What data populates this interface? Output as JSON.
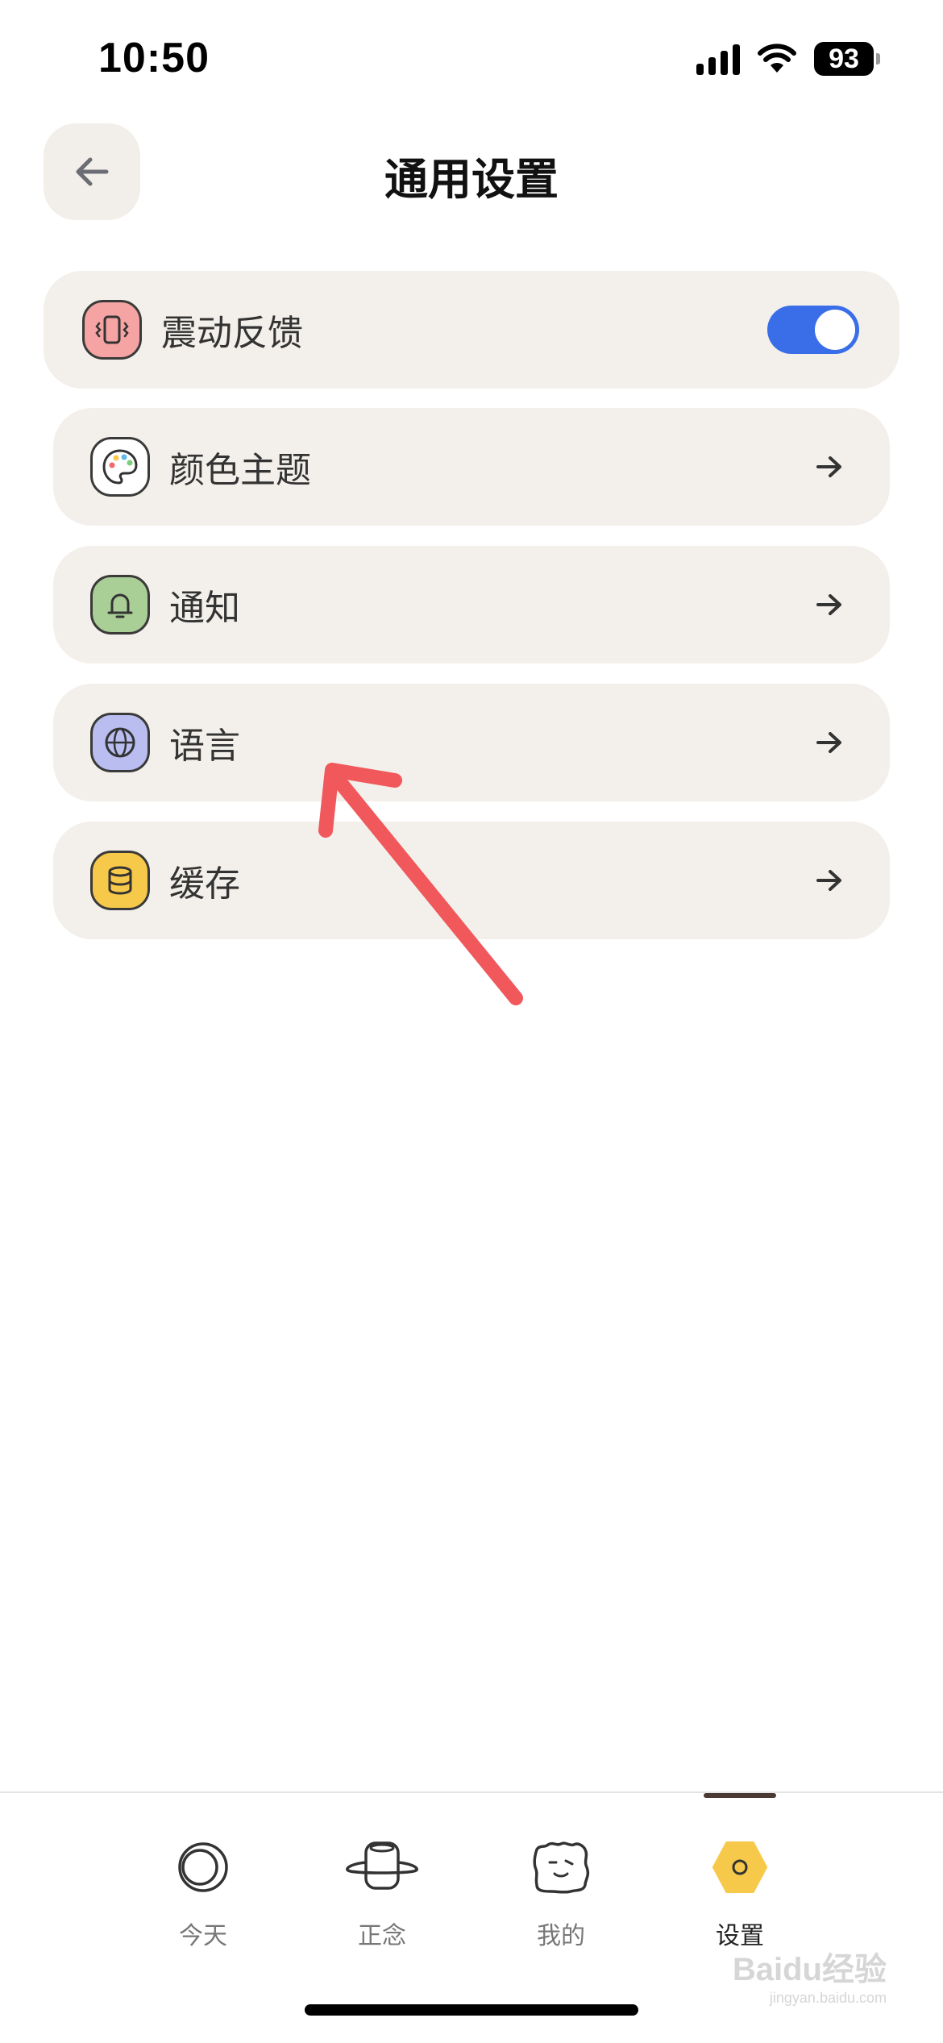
{
  "status_bar": {
    "time": "10:50",
    "battery": "93"
  },
  "header": {
    "title": "通用设置"
  },
  "settings": [
    {
      "label": "震动反馈",
      "icon": "vibration-icon",
      "icon_bg": "#f5a3a3",
      "control": "toggle",
      "toggle_on": true
    },
    {
      "label": "颜色主题",
      "icon": "palette-icon",
      "icon_bg": "#ffffff",
      "control": "arrow"
    },
    {
      "label": "通知",
      "icon": "bell-icon",
      "icon_bg": "#a9cf96",
      "control": "arrow"
    },
    {
      "label": "语言",
      "icon": "globe-icon",
      "icon_bg": "#b9bdf0",
      "control": "arrow"
    },
    {
      "label": "缓存",
      "icon": "database-icon",
      "icon_bg": "#f7c94a",
      "control": "arrow"
    }
  ],
  "tabs": [
    {
      "label": "今天",
      "icon": "moon-circle-icon",
      "active": false
    },
    {
      "label": "正念",
      "icon": "planet-icon",
      "active": false
    },
    {
      "label": "我的",
      "icon": "face-icon",
      "active": false
    },
    {
      "label": "设置",
      "icon": "hexagon-icon",
      "active": true
    }
  ],
  "watermark": {
    "text": "Baidu经验",
    "url": "jingyan.baidu.com"
  },
  "colors": {
    "card_bg": "#f3f0eb",
    "toggle_on": "#3a6ee8",
    "annotation_arrow": "#f0585c",
    "active_tab_icon": "#f7c94a"
  }
}
